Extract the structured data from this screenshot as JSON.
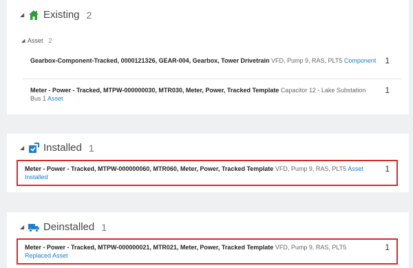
{
  "groups": [
    {
      "title": "Existing",
      "count": "2",
      "subgroup": {
        "label": "Asset",
        "count": "2"
      },
      "items": [
        {
          "name": "Gearbox-Component-Tracked, 0000121326, GEAR-004, Gearbox, Tower Drivetrain",
          "location": "VFD, Pump 9, RAS, PLT5",
          "tag": "Component",
          "qty": "1"
        },
        {
          "name": "Meter - Power - Tracked, MTPW-000000030, MTR030, Meter, Power, Tracked Template",
          "location": "Capacitor 12 - Lake Substation Bus 1",
          "tag": "Asset",
          "qty": "1"
        }
      ]
    },
    {
      "title": "Installed",
      "count": "1",
      "items": [
        {
          "name": "Meter - Power - Tracked, MTPW-000000060, MTR060, Meter, Power, Tracked Template",
          "location": "VFD, Pump 9, RAS, PLT5",
          "tag": "Asset Installed",
          "qty": "1"
        }
      ]
    },
    {
      "title": "Deinstalled",
      "count": "1",
      "items": [
        {
          "name": "Meter - Power - Tracked, MTPW-000000021, MTR021, Meter, Power, Tracked Template",
          "location": "VFD, Pump 9, RAS, PLT5",
          "tag": "Replaced Asset",
          "qty": "1"
        }
      ]
    }
  ],
  "colors": {
    "accent_green": "#2e9c3a",
    "accent_blue": "#1f7fc9",
    "highlight_red": "#d42a2a",
    "link": "#1a7fc4"
  },
  "icons": {
    "expand": "triangle-down-icon",
    "existing": "house-icon",
    "installed": "installed-icon",
    "deinstalled": "truck-icon"
  }
}
